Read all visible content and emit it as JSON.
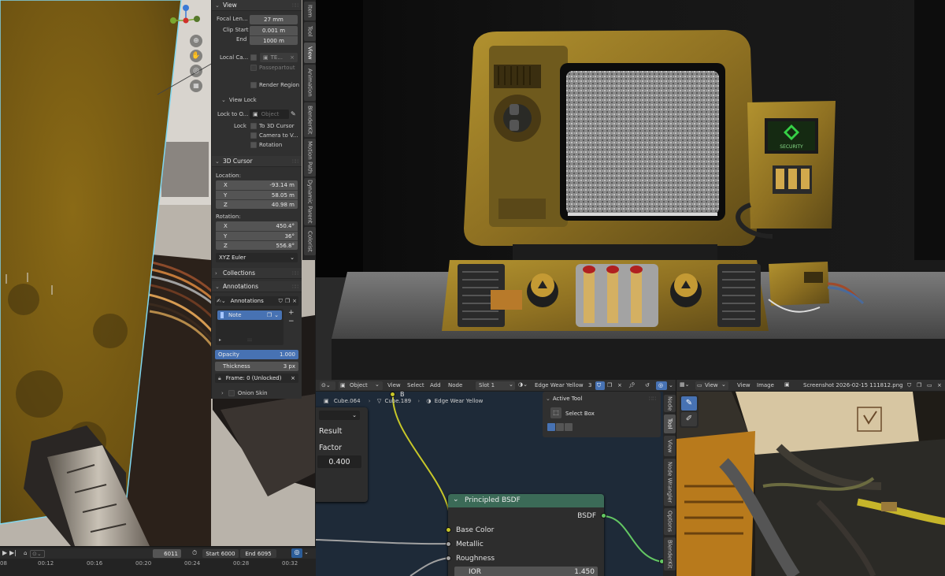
{
  "n_panel": {
    "view": {
      "title": "View",
      "focal_length_label": "Focal Len...",
      "focal_length": "27 mm",
      "clip_start_label": "Clip Start",
      "clip_start": "0.001 m",
      "clip_end_label": "End",
      "clip_end": "1000 m",
      "local_camera_label": "Local Ca...",
      "local_camera_value": "TE...",
      "passepartout": "Passepartout",
      "render_region": "Render Region"
    },
    "view_lock": {
      "title": "View Lock",
      "lock_to_object_label": "Lock to O...",
      "lock_to_object_placeholder": "Object",
      "lock_label": "Lock",
      "to_3d_cursor": "To 3D Cursor",
      "camera_to_view": "Camera to V...",
      "rotation": "Rotation"
    },
    "cursor": {
      "title": "3D Cursor",
      "location_label": "Location:",
      "loc": [
        {
          "axis": "X",
          "value": "-93.14 m"
        },
        {
          "axis": "Y",
          "value": "58.05 m"
        },
        {
          "axis": "Z",
          "value": "40.98 m"
        }
      ],
      "rotation_label": "Rotation:",
      "rot": [
        {
          "axis": "X",
          "value": "450.4°"
        },
        {
          "axis": "Y",
          "value": "36°"
        },
        {
          "axis": "Z",
          "value": "556.8°"
        }
      ],
      "rotation_mode": "XYZ Euler"
    },
    "collections": {
      "title": "Collections"
    },
    "annotations": {
      "title": "Annotations",
      "datablock": "Annotations",
      "layer_name": "Note",
      "opacity_label": "Opacity",
      "opacity_value": "1.000",
      "thickness_label": "Thickness",
      "thickness_value": "3 px",
      "frame_label": "Frame: 0 (Unlocked)",
      "onion_skin": "Onion Skin"
    }
  },
  "side_tabs": [
    "Item",
    "Tool",
    "View",
    "Animation",
    "BlenderKit",
    "Motion Path",
    "Dynamic Parent",
    "Colorist"
  ],
  "active_side_tab": "View",
  "timeline": {
    "current_frame": "6011",
    "start_label": "Start",
    "start_value": "6000",
    "end_label": "End",
    "end_value": "6095",
    "ruler": [
      "08",
      "00:12",
      "00:16",
      "00:20",
      "00:24",
      "00:28",
      "00:32"
    ]
  },
  "node_editor": {
    "mode": "Object",
    "menus": [
      "View",
      "Select",
      "Add",
      "Node"
    ],
    "slot": "Slot 1",
    "material": "Edge Wear Yellow",
    "user_count": "3",
    "breadcrumb": [
      "Cube.064",
      "Cube.189",
      "Edge Wear Yellow"
    ],
    "side_tabs": [
      "Node",
      "Tool",
      "View",
      "Node Wrangler",
      "Options",
      "BlenderKit"
    ],
    "active_side_tab": "Tool",
    "active_tool_title": "Active Tool",
    "active_tool_name": "Select Box",
    "mix_node": {
      "output_b": "B",
      "result_label": "Result",
      "factor_label": "Factor",
      "factor_value": "0.400"
    },
    "bsdf_node": {
      "title": "Principled BSDF",
      "output": "BSDF",
      "inputs": [
        "Base Color",
        "Metallic",
        "Roughness"
      ],
      "ior_label": "IOR",
      "ior_value": "1.450"
    },
    "colors": {
      "bsdf_header": "#3b6a57",
      "socket_yellow": "#c7c729",
      "socket_green": "#63c763",
      "socket_grey": "#a1a1a1"
    }
  },
  "image_editor": {
    "menus": [
      "View",
      "View",
      "Image"
    ],
    "image_name": "Screenshot 2026-02-15 111812.png"
  },
  "render_view": {
    "screen_label": "SECURITY"
  }
}
